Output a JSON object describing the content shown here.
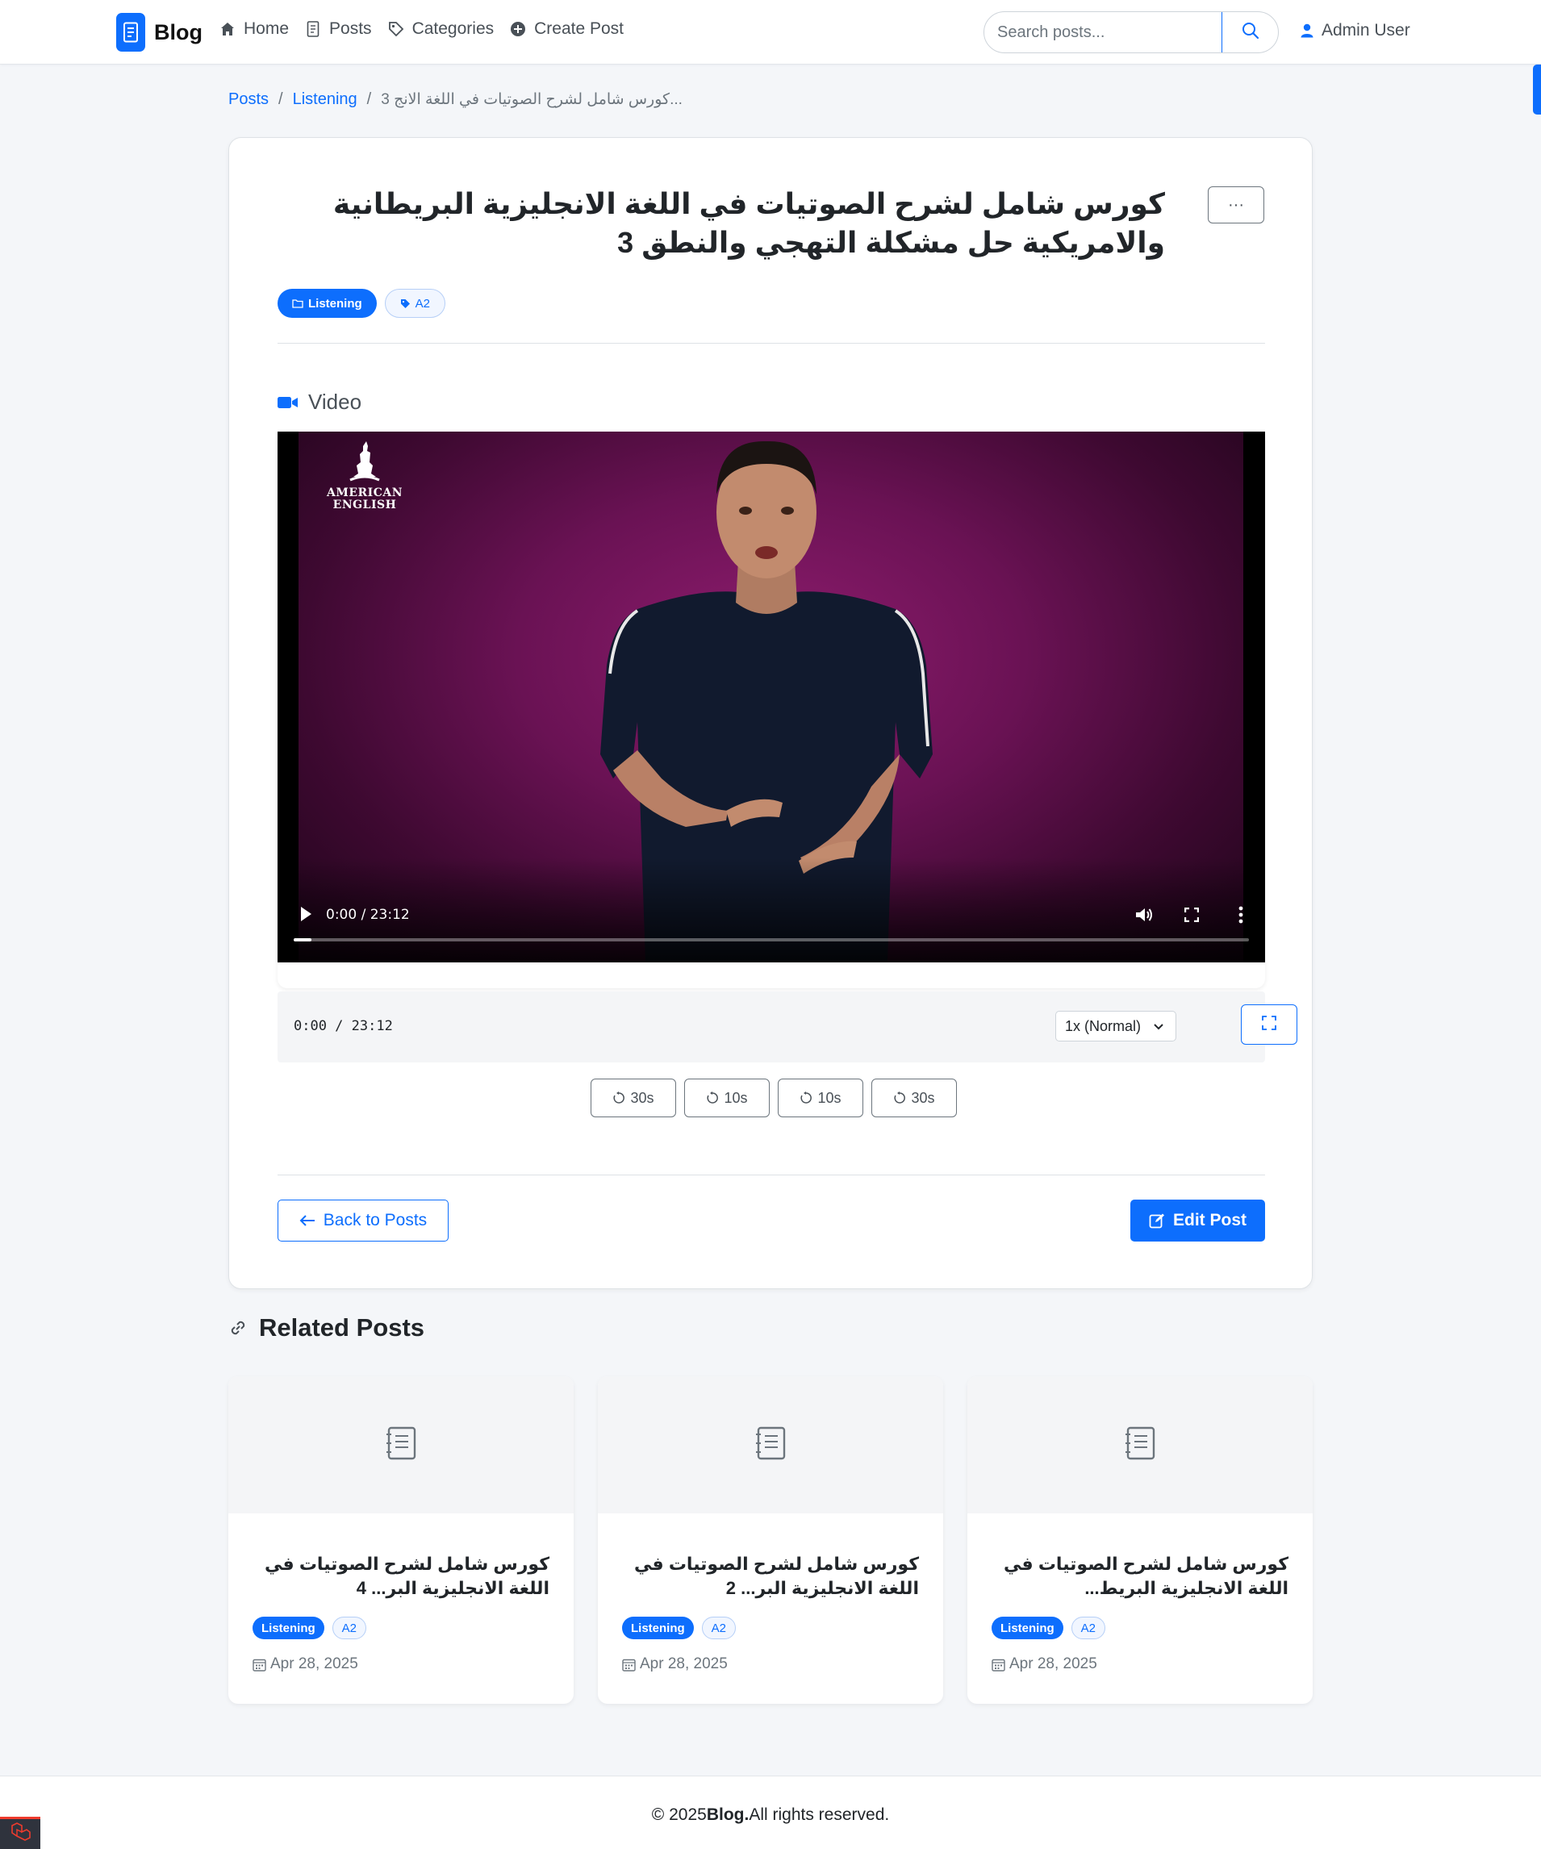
{
  "navbar": {
    "brand": "Blog",
    "links": [
      {
        "label": "Home",
        "icon": "home-icon"
      },
      {
        "label": "Posts",
        "icon": "posts-icon"
      },
      {
        "label": "Categories",
        "icon": "tags-icon"
      },
      {
        "label": "Create Post",
        "icon": "plus-circle-icon"
      }
    ],
    "search_placeholder": "Search posts...",
    "user": "Admin User"
  },
  "breadcrumb": {
    "items": [
      "Posts",
      "Listening"
    ],
    "separator": "/",
    "current": "كورس شامل لشرح الصوتيات في اللغة الانج 3..."
  },
  "post": {
    "title": "كورس شامل لشرح الصوتيات في اللغة الانجليزية البريطانية والامريكية حل مشكلة التهجي والنطق 3",
    "more_label": "···",
    "category": "Listening",
    "level": "A2",
    "video_section": "Video",
    "video": {
      "logo_line1": "AMERICAN",
      "logo_line2": "ENGLISH",
      "time": "0:00 / 23:12",
      "progress": 0
    },
    "player": {
      "time": "0:00 / 23:12",
      "speed": "1x (Normal)"
    },
    "seek_buttons": [
      "30s",
      "10s",
      "10s",
      "30s"
    ],
    "back_label": "Back to Posts",
    "edit_label": "Edit Post"
  },
  "related": {
    "heading": "Related Posts",
    "items": [
      {
        "title": "كورس شامل لشرح الصوتيات في اللغة الانجليزية البر... 4",
        "category": "Listening",
        "level": "A2",
        "date": "Apr 28, 2025"
      },
      {
        "title": "كورس شامل لشرح الصوتيات في اللغة الانجليزية البر... 2",
        "category": "Listening",
        "level": "A2",
        "date": "Apr 28, 2025"
      },
      {
        "title": "كورس شامل لشرح الصوتيات في اللغة الانجليزية البريط...",
        "category": "Listening",
        "level": "A2",
        "date": "Apr 28, 2025"
      }
    ]
  },
  "footer": {
    "prefix": "© 2025",
    "brand": "Blog.",
    "suffix": "All rights reserved."
  },
  "colors": {
    "primary": "#0d6efd",
    "background": "#f4f6f9",
    "video_bg": "#6a1254"
  }
}
